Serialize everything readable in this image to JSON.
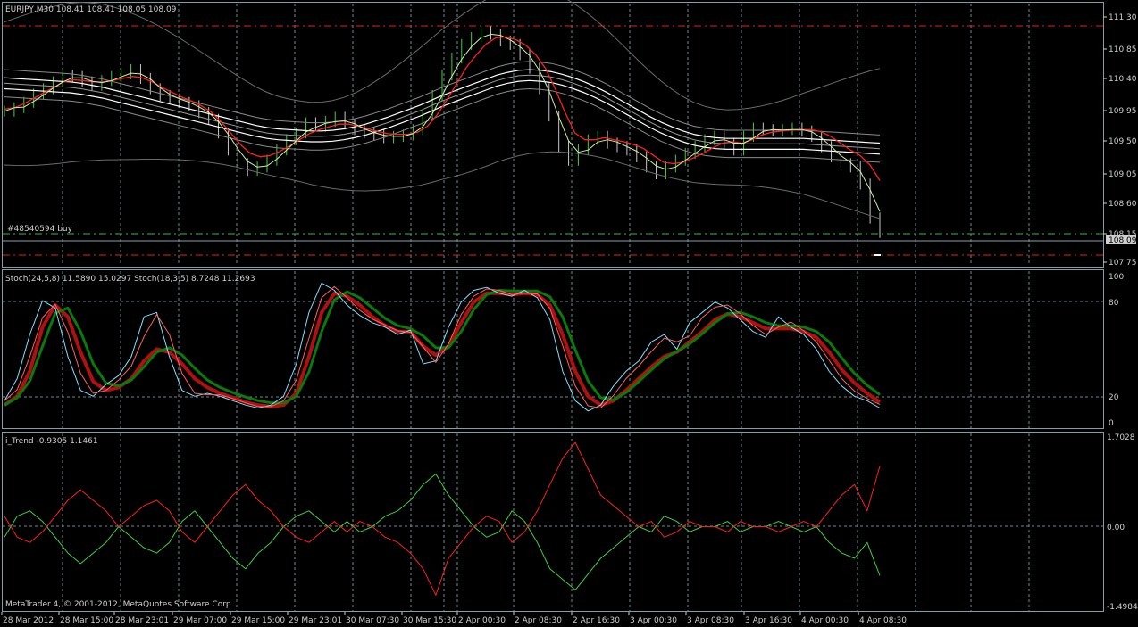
{
  "window": {
    "title": "EURJPY,M30  108.41 108.41 108.05 108.09",
    "order_label": "#48540594 buy",
    "copyright": "MetaTrader 4, © 2001-2012, MetaQuotes Software Corp."
  },
  "price_panel": {
    "current_price": "108.09",
    "ticks": [
      "111.30",
      "110.85",
      "110.40",
      "109.95",
      "109.50",
      "109.05",
      "108.60",
      "108.15",
      "107.75"
    ]
  },
  "stoch_panel": {
    "title": "Stoch(24,5,8) 11.5890 15.0297  Stoch(18,3,5) 8.7248 11.2693",
    "ticks": [
      "100",
      "80",
      "20",
      "0"
    ]
  },
  "trend_panel": {
    "title": "i_Trend -0.9305 1.1461",
    "ticks": [
      "1.7028",
      "0.00",
      "-1.4984"
    ]
  },
  "time_axis": [
    "28 Mar 2012",
    "28 Mar 15:00",
    "28 Mar 23:01",
    "29 Mar 07:00",
    "29 Mar 15:00",
    "29 Mar 23:01",
    "30 Mar 07:30",
    "30 Mar 15:30",
    "2 Apr 00:30",
    "2 Apr 08:30",
    "2 Apr 16:30",
    "3 Apr 00:30",
    "3 Apr 08:30",
    "3 Apr 16:30",
    "4 Apr 00:30",
    "4 Apr 08:30"
  ],
  "colors": {
    "background": "#000000",
    "grid": "#6f8a8f",
    "panel_border": "#7fa0a8",
    "candles": "#c8c8c8",
    "red_line": "#ff2020",
    "green_line": "#40d040",
    "white_line": "#ffffff",
    "stoch_green": "#0a7a0a",
    "stoch_red": "#b01010"
  },
  "chart_data": [
    {
      "type": "line",
      "title": "EURJPY,M30  108.41 108.41 108.05 108.09",
      "ylim": [
        107.6,
        111.45
      ],
      "close": [
        109.87,
        109.92,
        110.0,
        110.12,
        110.2,
        110.3,
        110.4,
        110.38,
        110.3,
        110.25,
        110.32,
        110.38,
        110.42,
        110.48,
        110.35,
        110.2,
        110.1,
        110.05,
        110.0,
        109.95,
        109.85,
        109.75,
        109.55,
        109.3,
        109.1,
        109.0,
        109.05,
        109.15,
        109.3,
        109.45,
        109.55,
        109.7,
        109.65,
        109.72,
        109.78,
        109.68,
        109.6,
        109.55,
        109.52,
        109.48,
        109.5,
        109.52,
        109.6,
        109.8,
        110.1,
        110.4,
        110.65,
        110.85,
        110.95,
        111.05,
        111.0,
        110.9,
        110.85,
        110.7,
        110.5,
        110.2,
        109.8,
        109.35,
        109.15,
        109.3,
        109.45,
        109.5,
        109.4,
        109.35,
        109.3,
        109.2,
        109.05,
        108.95,
        109.05,
        109.15,
        109.25,
        109.35,
        109.45,
        109.5,
        109.4,
        109.3,
        109.5,
        109.62,
        109.6,
        109.58,
        109.6,
        109.62,
        109.58,
        109.5,
        109.35,
        109.2,
        109.1,
        109.05,
        108.8,
        108.3,
        108.09
      ],
      "ma_red": [
        109.9,
        109.92,
        109.98,
        110.06,
        110.14,
        110.22,
        110.3,
        110.33,
        110.32,
        110.3,
        110.3,
        110.32,
        110.35,
        110.38,
        110.36,
        110.3,
        110.22,
        110.15,
        110.08,
        110.02,
        109.95,
        109.86,
        109.72,
        109.55,
        109.38,
        109.25,
        109.2,
        109.22,
        109.28,
        109.36,
        109.45,
        109.54,
        109.6,
        109.64,
        109.68,
        109.68,
        109.65,
        109.61,
        109.57,
        109.54,
        109.53,
        109.53,
        109.56,
        109.65,
        109.82,
        110.04,
        110.28,
        110.52,
        110.7,
        110.86,
        110.95,
        110.96,
        110.92,
        110.84,
        110.7,
        110.5,
        110.2,
        109.85,
        109.55,
        109.45,
        109.45,
        109.48,
        109.45,
        109.42,
        109.38,
        109.32,
        109.22,
        109.12,
        109.1,
        109.12,
        109.18,
        109.25,
        109.33,
        109.4,
        109.42,
        109.4,
        109.45,
        109.52,
        109.56,
        109.58,
        109.59,
        109.6,
        109.6,
        109.57,
        109.5,
        109.4,
        109.3,
        109.22,
        109.08,
        108.85
      ],
      "ma_white": [
        110.28,
        110.27,
        110.26,
        110.25,
        110.24,
        110.23,
        110.22,
        110.2,
        110.17,
        110.14,
        110.1,
        110.06,
        110.02,
        109.98,
        109.94,
        109.9,
        109.86,
        109.82,
        109.78,
        109.74,
        109.7,
        109.66,
        109.62,
        109.58,
        109.55,
        109.53,
        109.52,
        109.51,
        109.5,
        109.5,
        109.51,
        109.53,
        109.56,
        109.6,
        109.65,
        109.7,
        109.76,
        109.82,
        109.88,
        109.95,
        110.02,
        110.08,
        110.14,
        110.2,
        110.26,
        110.32,
        110.36,
        110.39,
        110.4,
        110.39,
        110.37,
        110.33,
        110.28,
        110.22,
        110.15,
        110.07,
        109.98,
        109.89,
        109.8,
        109.71,
        109.63,
        109.56,
        109.5,
        109.45,
        109.42,
        109.4,
        109.39,
        109.39,
        109.39,
        109.39,
        109.39,
        109.39,
        109.39,
        109.39,
        109.38,
        109.37,
        109.36,
        109.35,
        109.34,
        109.33,
        109.32
      ]
    },
    {
      "type": "line",
      "title": "Stoch(24,5,8) 11.5890 15.0297  Stoch(18,3,5) 8.7248 11.2693",
      "ylim": [
        0,
        100
      ],
      "fast": [
        15,
        30,
        60,
        83,
        78,
        45,
        22,
        18,
        26,
        32,
        45,
        72,
        75,
        45,
        22,
        18,
        20,
        18,
        15,
        12,
        10,
        12,
        18,
        40,
        75,
        95,
        90,
        80,
        73,
        68,
        65,
        60,
        63,
        40,
        42,
        65,
        82,
        90,
        92,
        88,
        86,
        90,
        85,
        70,
        35,
        15,
        8,
        12,
        25,
        35,
        42,
        55,
        60,
        50,
        68,
        75,
        82,
        78,
        70,
        62,
        58,
        72,
        65,
        60,
        50,
        35,
        25,
        18,
        15,
        10
      ],
      "slow": [
        12,
        18,
        35,
        65,
        80,
        72,
        48,
        28,
        22,
        24,
        30,
        42,
        50,
        48,
        40,
        30,
        24,
        20,
        17,
        14,
        12,
        11,
        12,
        20,
        45,
        75,
        88,
        86,
        80,
        72,
        66,
        62,
        62,
        52,
        46,
        52,
        68,
        82,
        88,
        88,
        87,
        88,
        87,
        80,
        60,
        35,
        18,
        12,
        15,
        22,
        30,
        38,
        45,
        48,
        55,
        62,
        70,
        74,
        72,
        68,
        64,
        64,
        64,
        62,
        58,
        48,
        36,
        27,
        20,
        14
      ]
    },
    {
      "type": "line",
      "title": "i_Trend -0.9305 1.1461",
      "ylim": [
        -1.4984,
        1.7028
      ],
      "red": [
        0.2,
        -0.2,
        -0.3,
        -0.1,
        0.2,
        0.5,
        0.7,
        0.5,
        0.3,
        0.0,
        0.2,
        0.4,
        0.5,
        0.3,
        -0.1,
        -0.3,
        0.0,
        0.3,
        0.6,
        0.8,
        0.5,
        0.3,
        0.0,
        -0.2,
        -0.3,
        -0.1,
        0.1,
        -0.1,
        0.1,
        0.0,
        -0.2,
        -0.3,
        -0.5,
        -0.8,
        -1.3,
        -0.6,
        -0.3,
        0.0,
        0.2,
        0.1,
        -0.3,
        -0.1,
        0.3,
        0.8,
        1.3,
        1.6,
        1.1,
        0.6,
        0.4,
        0.2,
        0.0,
        0.1,
        -0.2,
        -0.1,
        0.1,
        0.0,
        0.0,
        -0.1,
        0.1,
        0.0,
        0.0,
        -0.1,
        0.0,
        0.1,
        0.0,
        0.3,
        0.6,
        0.8,
        0.3,
        1.15
      ],
      "green": [
        -0.2,
        0.2,
        0.3,
        0.1,
        -0.2,
        -0.5,
        -0.7,
        -0.5,
        -0.3,
        0.0,
        -0.2,
        -0.4,
        -0.5,
        -0.3,
        0.1,
        0.3,
        0.0,
        -0.3,
        -0.6,
        -0.8,
        -0.5,
        -0.3,
        0.0,
        0.2,
        0.3,
        0.1,
        -0.1,
        0.1,
        -0.1,
        0.0,
        0.2,
        0.3,
        0.5,
        0.8,
        1.0,
        0.6,
        0.3,
        0.0,
        -0.2,
        -0.1,
        0.3,
        0.1,
        -0.3,
        -0.8,
        -1.0,
        -1.2,
        -0.9,
        -0.6,
        -0.4,
        -0.2,
        0.0,
        -0.1,
        0.2,
        0.1,
        -0.1,
        0.0,
        0.0,
        0.1,
        -0.1,
        0.0,
        0.0,
        0.1,
        0.0,
        -0.1,
        0.0,
        -0.3,
        -0.5,
        -0.6,
        -0.3,
        -0.93
      ]
    }
  ]
}
